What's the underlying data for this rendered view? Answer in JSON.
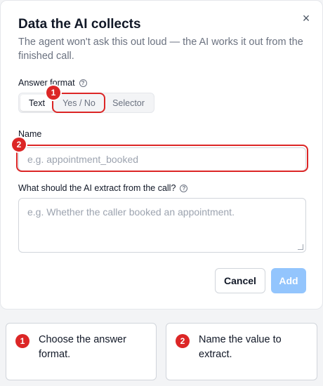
{
  "modal": {
    "title": "Data the AI collects",
    "description": "The agent won't ask this out loud — the AI works it out from the finished call.",
    "close_icon": "×"
  },
  "answer_format": {
    "label": "Answer format",
    "help_icon": "?",
    "options": [
      "Text",
      "Yes / No",
      "Selector"
    ],
    "selected": "Text"
  },
  "name_field": {
    "label": "Name",
    "placeholder": "e.g. appointment_booked"
  },
  "extract_field": {
    "label": "What should the AI extract from the call?",
    "help_icon": "?",
    "placeholder": "e.g. Whether the caller booked an appointment."
  },
  "buttons": {
    "cancel": "Cancel",
    "add": "Add"
  },
  "annotations": {
    "colors": {
      "highlight": "#dc2626"
    },
    "markers": [
      "1",
      "2"
    ],
    "callouts": [
      {
        "number": "1",
        "text": "Choose the answer format."
      },
      {
        "number": "2",
        "text": "Name the value to extract."
      }
    ]
  }
}
